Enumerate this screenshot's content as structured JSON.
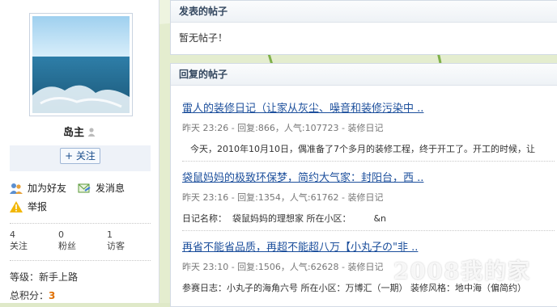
{
  "profile": {
    "username": "岛主",
    "follow_label": "+ 关注",
    "actions": {
      "add_friend": "加为好友",
      "send_message": "发消息",
      "report": "举报"
    },
    "stats": [
      {
        "value": "4",
        "label": "关注"
      },
      {
        "value": "0",
        "label": "粉丝"
      },
      {
        "value": "1",
        "label": "访客"
      }
    ],
    "level_text": "等级：新手上路",
    "score_label": "总积分：",
    "score_value": "3"
  },
  "posted": {
    "heading": "发表的帖子",
    "empty_text": "暂无帖子！"
  },
  "replied": {
    "heading": "回复的帖子",
    "posts": [
      {
        "title": "雷人的装修日记（让家从灰尘、噪音和装修污染中 ..",
        "meta": "昨天 23:26 - 回复:866，人气:107723 - 装修日记",
        "excerpt": "今天，2010年10月10日，偶准备了7个多月的装修工程，终于开工了。开工的时候，让"
      },
      {
        "title": "袋鼠妈妈的极致环保梦，简约大气家：封阳台，西 ..",
        "meta": "昨天 23:16 - 回复:1354，人气:61762 - 装修日记",
        "excerpt": "日记名称：  袋鼠妈妈的理想家 所在小区：        &n"
      },
      {
        "title": "再省不能省品质，再超不能超八万【小丸子の\"非 ..",
        "meta": "昨天 23:10 - 回复:1506，人气:62628 - 装修日记",
        "excerpt": "参赛日志：小丸子的海角六号 所在小区：万博汇（一期） 装修风格：地中海（偏简约）"
      }
    ]
  },
  "watermark": "2008我的家",
  "icons": {
    "user": "user-icon",
    "add_friend": "add-friend-icon",
    "message": "message-icon",
    "report": "warning-icon"
  }
}
